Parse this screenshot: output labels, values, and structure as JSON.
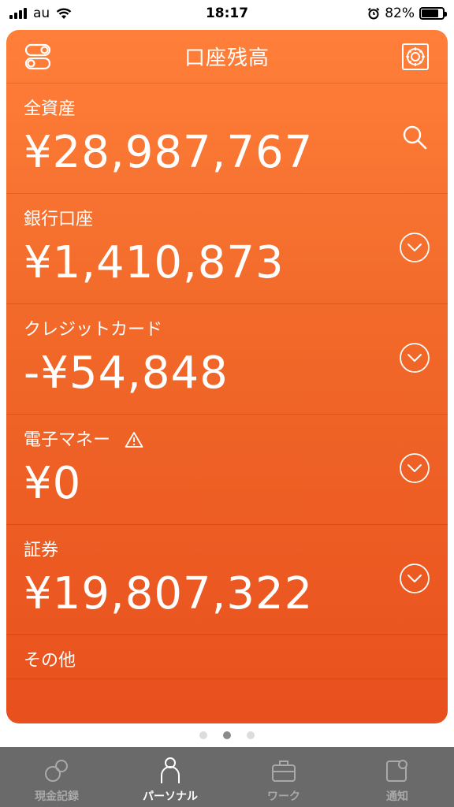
{
  "status_bar": {
    "carrier": "au",
    "time": "18:17",
    "battery_percent": "82%",
    "battery_level": 0.82
  },
  "header": {
    "title": "口座残高",
    "left_icon": "toggle-icon",
    "right_icon": "safe-icon"
  },
  "accounts": [
    {
      "label": "全資産",
      "value": "¥28,987,767",
      "action_icon": "search-icon"
    },
    {
      "label": "銀行口座",
      "value": "¥1,410,873",
      "action_icon": "chevron-down-circle-icon"
    },
    {
      "label": "クレジットカード",
      "value": "-¥54,848",
      "action_icon": "chevron-down-circle-icon"
    },
    {
      "label": "電子マネー",
      "value": "¥0",
      "action_icon": "chevron-down-circle-icon",
      "warning_icon": "warning-icon"
    },
    {
      "label": "証券",
      "value": "¥19,807,322",
      "action_icon": "chevron-down-circle-icon"
    },
    {
      "label": "その他"
    }
  ],
  "pager": {
    "count": 3,
    "active_index": 1
  },
  "tabs": [
    {
      "label": "現金記録",
      "icon": "circles-icon",
      "active": false
    },
    {
      "label": "パーソナル",
      "icon": "person-icon",
      "active": true
    },
    {
      "label": "ワーク",
      "icon": "briefcase-icon",
      "active": false
    },
    {
      "label": "通知",
      "icon": "notification-icon",
      "active": false
    }
  ],
  "colors": {
    "card_top": "#ff7f3a",
    "card_bottom": "#e8501d",
    "tab_bar": "#6a6a6a"
  }
}
